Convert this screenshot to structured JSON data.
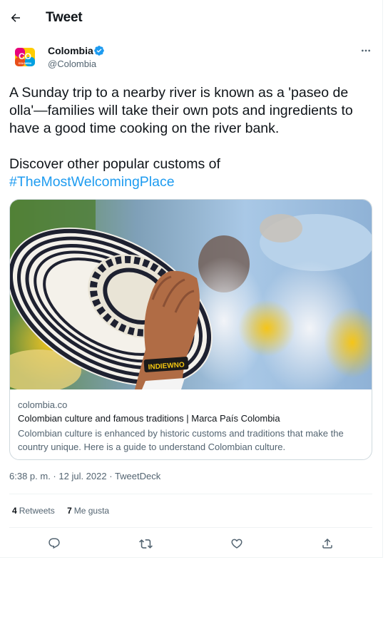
{
  "header": {
    "title": "Tweet",
    "back_icon": "arrow-left-icon"
  },
  "author": {
    "name": "Colombia",
    "handle": "@Colombia",
    "avatar_text": "CO",
    "avatar_subtext": "COLOMBIA",
    "verified_icon": "verified-badge-icon",
    "more_icon": "more-horizontal-icon"
  },
  "tweet": {
    "paragraph_1": "A Sunday trip to a nearby river is known as a 'paseo de olla'—families will take their own pots and ingredients to have a good time cooking on the river bank.",
    "paragraph_2": "Discover other popular customs of",
    "hashtag": "#TheMostWelcomingPlace"
  },
  "card": {
    "image_wristband_text": "INDIEWNO",
    "domain": "colombia.co",
    "title": "Colombian culture and famous traditions | Marca País Colombia",
    "description": "Colombian culture is enhanced by historic customs and traditions that make the country unique. Here is a guide to understand Colombian culture."
  },
  "meta": {
    "time": "6:38 p. m.",
    "separator": " · ",
    "date": "12 jul. 2022",
    "source": "TweetDeck"
  },
  "stats": {
    "retweets_count": "4",
    "retweets_label": "Retweets",
    "likes_count": "7",
    "likes_label": "Me gusta"
  },
  "actions": [
    "reply-icon",
    "retweet-icon",
    "like-icon",
    "share-icon"
  ],
  "colors": {
    "accent": "#1d9bf0",
    "text": "#0f1419",
    "secondary": "#536471",
    "border": "#cfd9de"
  }
}
